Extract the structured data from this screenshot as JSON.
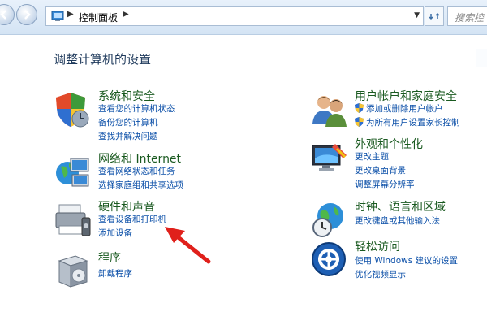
{
  "breadcrumb": {
    "current": "控制面板"
  },
  "search": {
    "placeholder": "搜索控"
  },
  "page": {
    "title": "调整计算机的设置"
  },
  "categories": {
    "system": {
      "title": "系统和安全",
      "links": [
        "查看您的计算机状态",
        "备份您的计算机",
        "查找并解决问题"
      ]
    },
    "network": {
      "title": "网络和 Internet",
      "links": [
        "查看网络状态和任务",
        "选择家庭组和共享选项"
      ]
    },
    "hardware": {
      "title": "硬件和声音",
      "links": [
        "查看设备和打印机",
        "添加设备"
      ]
    },
    "programs": {
      "title": "程序",
      "links": [
        "卸载程序"
      ]
    },
    "users": {
      "title": "用户帐户和家庭安全",
      "links": [
        "添加或删除用户帐户",
        "为所有用户设置家长控制"
      ]
    },
    "appearance": {
      "title": "外观和个性化",
      "links": [
        "更改主题",
        "更改桌面背景",
        "调整屏幕分辨率"
      ]
    },
    "clock": {
      "title": "时钟、语言和区域",
      "links": [
        "更改键盘或其他输入法"
      ]
    },
    "ease": {
      "title": "轻松访问",
      "links": [
        "使用 Windows 建议的设置",
        "优化视频显示"
      ]
    }
  },
  "colors": {
    "title_green": "#1a5a20",
    "link_blue": "#0b4fa8",
    "heading": "#1e395b",
    "annotation_arrow": "#e0201b"
  },
  "icons": [
    "back-arrow-icon",
    "forward-arrow-icon",
    "control-panel-icon",
    "refresh-icon",
    "shield-icon",
    "network-globe-icon",
    "printer-icon",
    "programs-box-icon",
    "users-icon",
    "monitor-icon",
    "globe-clock-icon",
    "ease-of-access-icon",
    "uac-shield-icon"
  ]
}
